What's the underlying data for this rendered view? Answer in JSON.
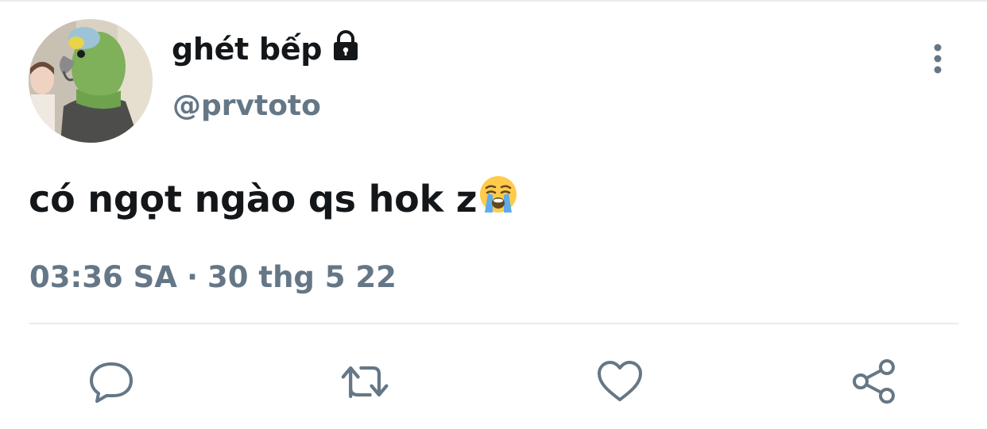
{
  "user": {
    "display_name": "ghét bếp",
    "handle": "@prvtoto",
    "protected_icon": "lock-icon",
    "avatar_icon": "parrot-mask-avatar"
  },
  "tweet": {
    "text": "có ngọt ngào qs hok z",
    "emoji": "loudly-crying-face-emoji",
    "time": "03:36 SA",
    "separator": "·",
    "date": "30 thg 5 22"
  },
  "actions": [
    {
      "name": "reply",
      "icon": "reply-icon"
    },
    {
      "name": "retweet",
      "icon": "retweet-icon"
    },
    {
      "name": "like",
      "icon": "heart-icon"
    },
    {
      "name": "share",
      "icon": "share-icon"
    }
  ],
  "menu": {
    "icon": "more-vertical-icon"
  },
  "colors": {
    "text_primary": "#14171a",
    "text_secondary": "#657786",
    "divider": "#e6ecf0",
    "icon": "#657786"
  }
}
